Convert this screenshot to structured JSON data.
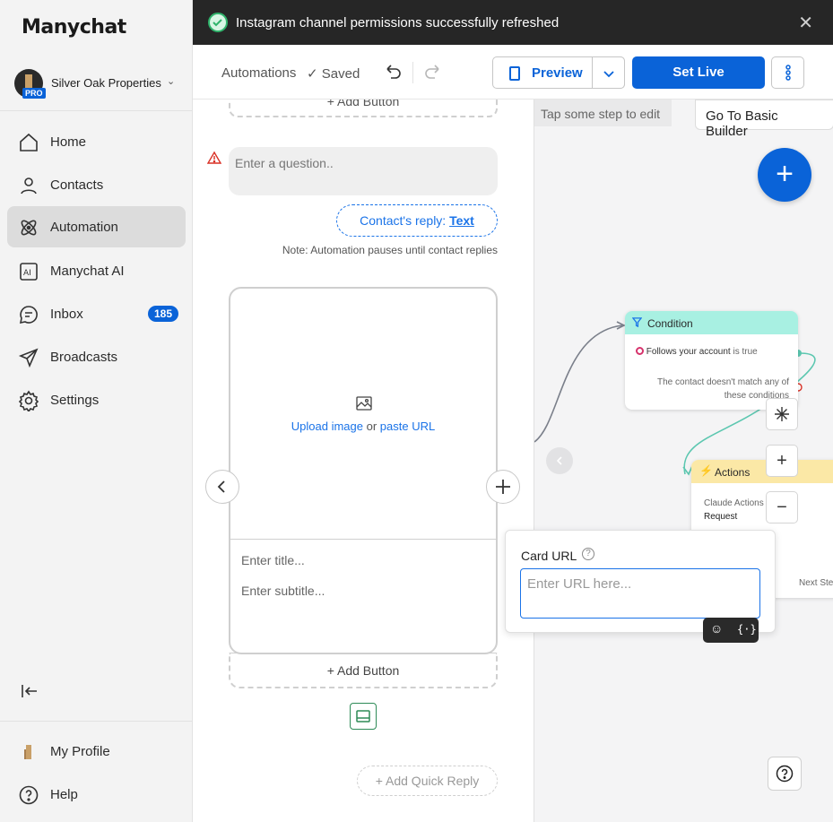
{
  "app": {
    "logo_text": "Manychat"
  },
  "account": {
    "name": "Silver Oak Properties",
    "plan_badge": "PRO"
  },
  "sidebar": {
    "items": [
      {
        "label": "Home",
        "icon": "home-icon",
        "active": false
      },
      {
        "label": "Contacts",
        "icon": "person-icon",
        "active": false
      },
      {
        "label": "Automation",
        "icon": "atom-icon",
        "active": true
      },
      {
        "label": "Manychat AI",
        "icon": "ai-icon",
        "active": false
      },
      {
        "label": "Inbox",
        "icon": "chat-icon",
        "active": false,
        "badge": "185"
      },
      {
        "label": "Broadcasts",
        "icon": "send-icon",
        "active": false
      },
      {
        "label": "Settings",
        "icon": "gear-icon",
        "active": false
      }
    ],
    "footer": [
      {
        "label": "My Profile",
        "icon": "profile-icon"
      },
      {
        "label": "Help",
        "icon": "help-icon"
      }
    ]
  },
  "toast": {
    "message": "Instagram channel permissions successfully refreshed"
  },
  "toolbar": {
    "breadcrumb": "Automations",
    "status": "Saved",
    "preview_label": "Preview",
    "set_live_label": "Set Live"
  },
  "editor": {
    "top_add_button": "+ Add Button",
    "question_placeholder": "Enter a question..",
    "reply_prefix": "Contact's reply:",
    "reply_type": "Text",
    "note": "Note: Automation pauses until contact replies",
    "card": {
      "upload_link": "Upload image",
      "or_text": "or",
      "paste_link": "paste URL",
      "title_placeholder": "Enter title...",
      "subtitle_placeholder": "Enter subtitle...",
      "add_button": "+ Add Button"
    },
    "quick_reply": "+ Add Quick Reply"
  },
  "canvas": {
    "hint": "Tap some step to edit",
    "basic_builder": "Go To Basic Builder",
    "condition_node": {
      "title": "Condition",
      "rule_bold": "Follows your account",
      "rule_suffix": "is true",
      "else_text": "The contact doesn't match any of these conditions"
    },
    "actions_node": {
      "title": "Actions",
      "line1": "Claude Actions",
      "line2": "Request",
      "next": "Next Ste"
    }
  },
  "popover": {
    "title": "Card URL",
    "input_placeholder": "Enter URL here...",
    "input_value": ""
  },
  "colors": {
    "accent": "#0a63d8",
    "toast_bg": "#262626",
    "condition": "#a8f0e2",
    "actions": "#fbe8a6"
  }
}
